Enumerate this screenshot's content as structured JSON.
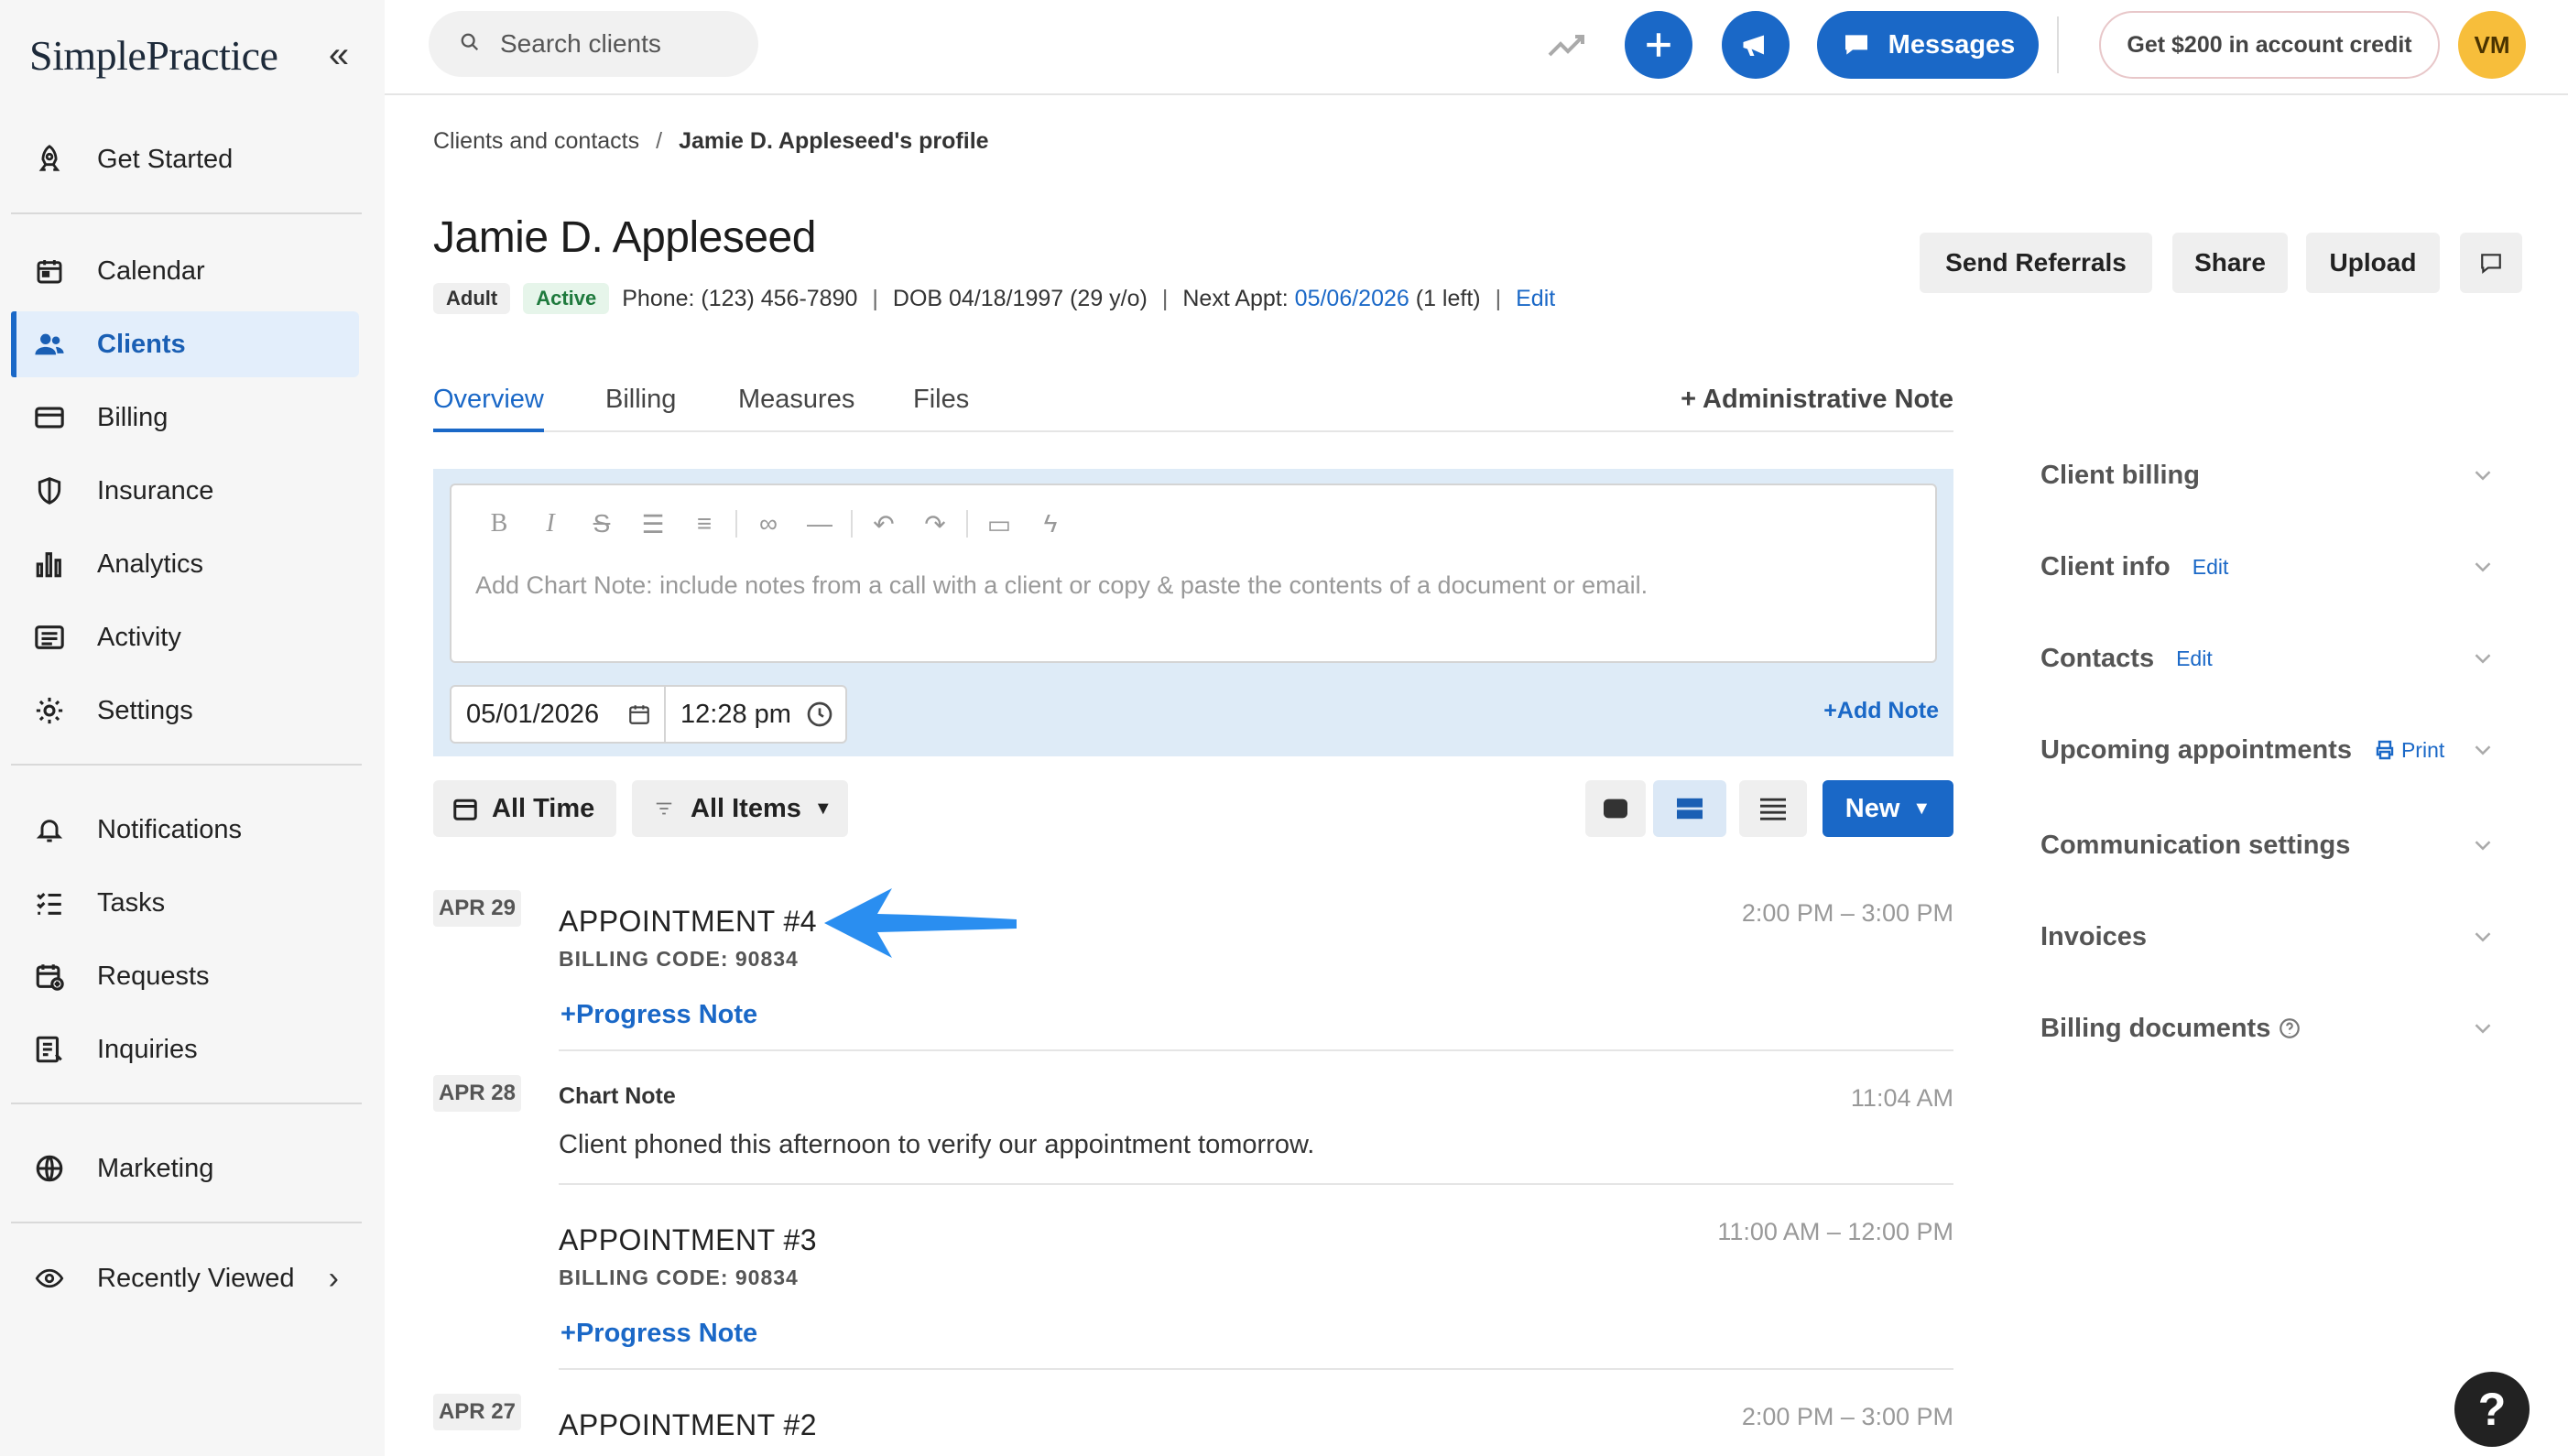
{
  "app": {
    "name": "SimplePractice"
  },
  "sidebar": {
    "items": [
      {
        "label": "Get Started",
        "icon": "rocket-icon"
      },
      {
        "label": "Calendar",
        "icon": "calendar-icon"
      },
      {
        "label": "Clients",
        "icon": "users-icon",
        "active": true
      },
      {
        "label": "Billing",
        "icon": "credit-card-icon"
      },
      {
        "label": "Insurance",
        "icon": "shield-icon"
      },
      {
        "label": "Analytics",
        "icon": "bar-chart-icon"
      },
      {
        "label": "Activity",
        "icon": "list-icon"
      },
      {
        "label": "Settings",
        "icon": "gear-icon"
      },
      {
        "label": "Notifications",
        "icon": "bell-icon"
      },
      {
        "label": "Tasks",
        "icon": "checklist-icon"
      },
      {
        "label": "Requests",
        "icon": "calendar-plus-icon"
      },
      {
        "label": "Inquiries",
        "icon": "inquiry-icon"
      },
      {
        "label": "Marketing",
        "icon": "globe-icon"
      },
      {
        "label": "Recently Viewed",
        "icon": "eye-icon"
      }
    ]
  },
  "topbar": {
    "search_placeholder": "Search clients",
    "messages_label": "Messages",
    "credit_label": "Get $200 in account credit",
    "avatar_initials": "VM"
  },
  "breadcrumb": {
    "parent": "Clients and contacts",
    "separator": "/",
    "current": "Jamie D. Appleseed's profile"
  },
  "client": {
    "name": "Jamie D. Appleseed",
    "badge_age": "Adult",
    "badge_status": "Active",
    "phone": "Phone: (123) 456-7890",
    "dob": "DOB 04/18/1997 (29 y/o)",
    "next_appt_label": "Next Appt:",
    "next_appt_date": "05/06/2026",
    "next_appt_left": "(1 left)",
    "edit_label": "Edit",
    "meta_sep": "|"
  },
  "header_buttons": {
    "send_referrals": "Send Referrals",
    "share": "Share",
    "upload": "Upload"
  },
  "tabs": [
    {
      "label": "Overview"
    },
    {
      "label": "Billing"
    },
    {
      "label": "Measures"
    },
    {
      "label": "Files"
    }
  ],
  "admin_note_label": "Administrative Note",
  "note_editor": {
    "placeholder": "Add Chart Note: include notes from a call with a client or copy & paste the contents of a document or email.",
    "date": "05/01/2026",
    "time": "12:28 pm",
    "add_note_label": "Add Note"
  },
  "filters": {
    "time": "All Time",
    "items": "All Items",
    "new_label": "New"
  },
  "timeline": [
    {
      "date": "APR 29",
      "title": "APPOINTMENT #4",
      "billing_code": "BILLING CODE: 90834",
      "time": "2:00 PM – 3:00 PM",
      "action": "Progress Note"
    },
    {
      "date": "APR 28",
      "title": "Chart Note",
      "body": "Client phoned this afternoon to verify our appointment tomorrow.",
      "time": "11:04 AM"
    },
    {
      "title": "APPOINTMENT #3",
      "billing_code": "BILLING CODE: 90834",
      "time": "11:00 AM – 12:00 PM",
      "action": "Progress Note"
    },
    {
      "date": "APR 27",
      "title": "APPOINTMENT #2",
      "time": "2:00 PM – 3:00 PM"
    }
  ],
  "right_panel": [
    {
      "label": "Client billing"
    },
    {
      "label": "Client info",
      "action": "Edit"
    },
    {
      "label": "Contacts",
      "action": "Edit"
    },
    {
      "label": "Upcoming appointments",
      "action": "Print"
    },
    {
      "label": "Communication settings"
    },
    {
      "label": "Invoices"
    },
    {
      "label": "Billing documents"
    }
  ],
  "help_label": "?",
  "colors": {
    "accent": "#1a68c7",
    "avatar": "#f7be3b",
    "annotation_arrow": "#2a8ef0"
  }
}
